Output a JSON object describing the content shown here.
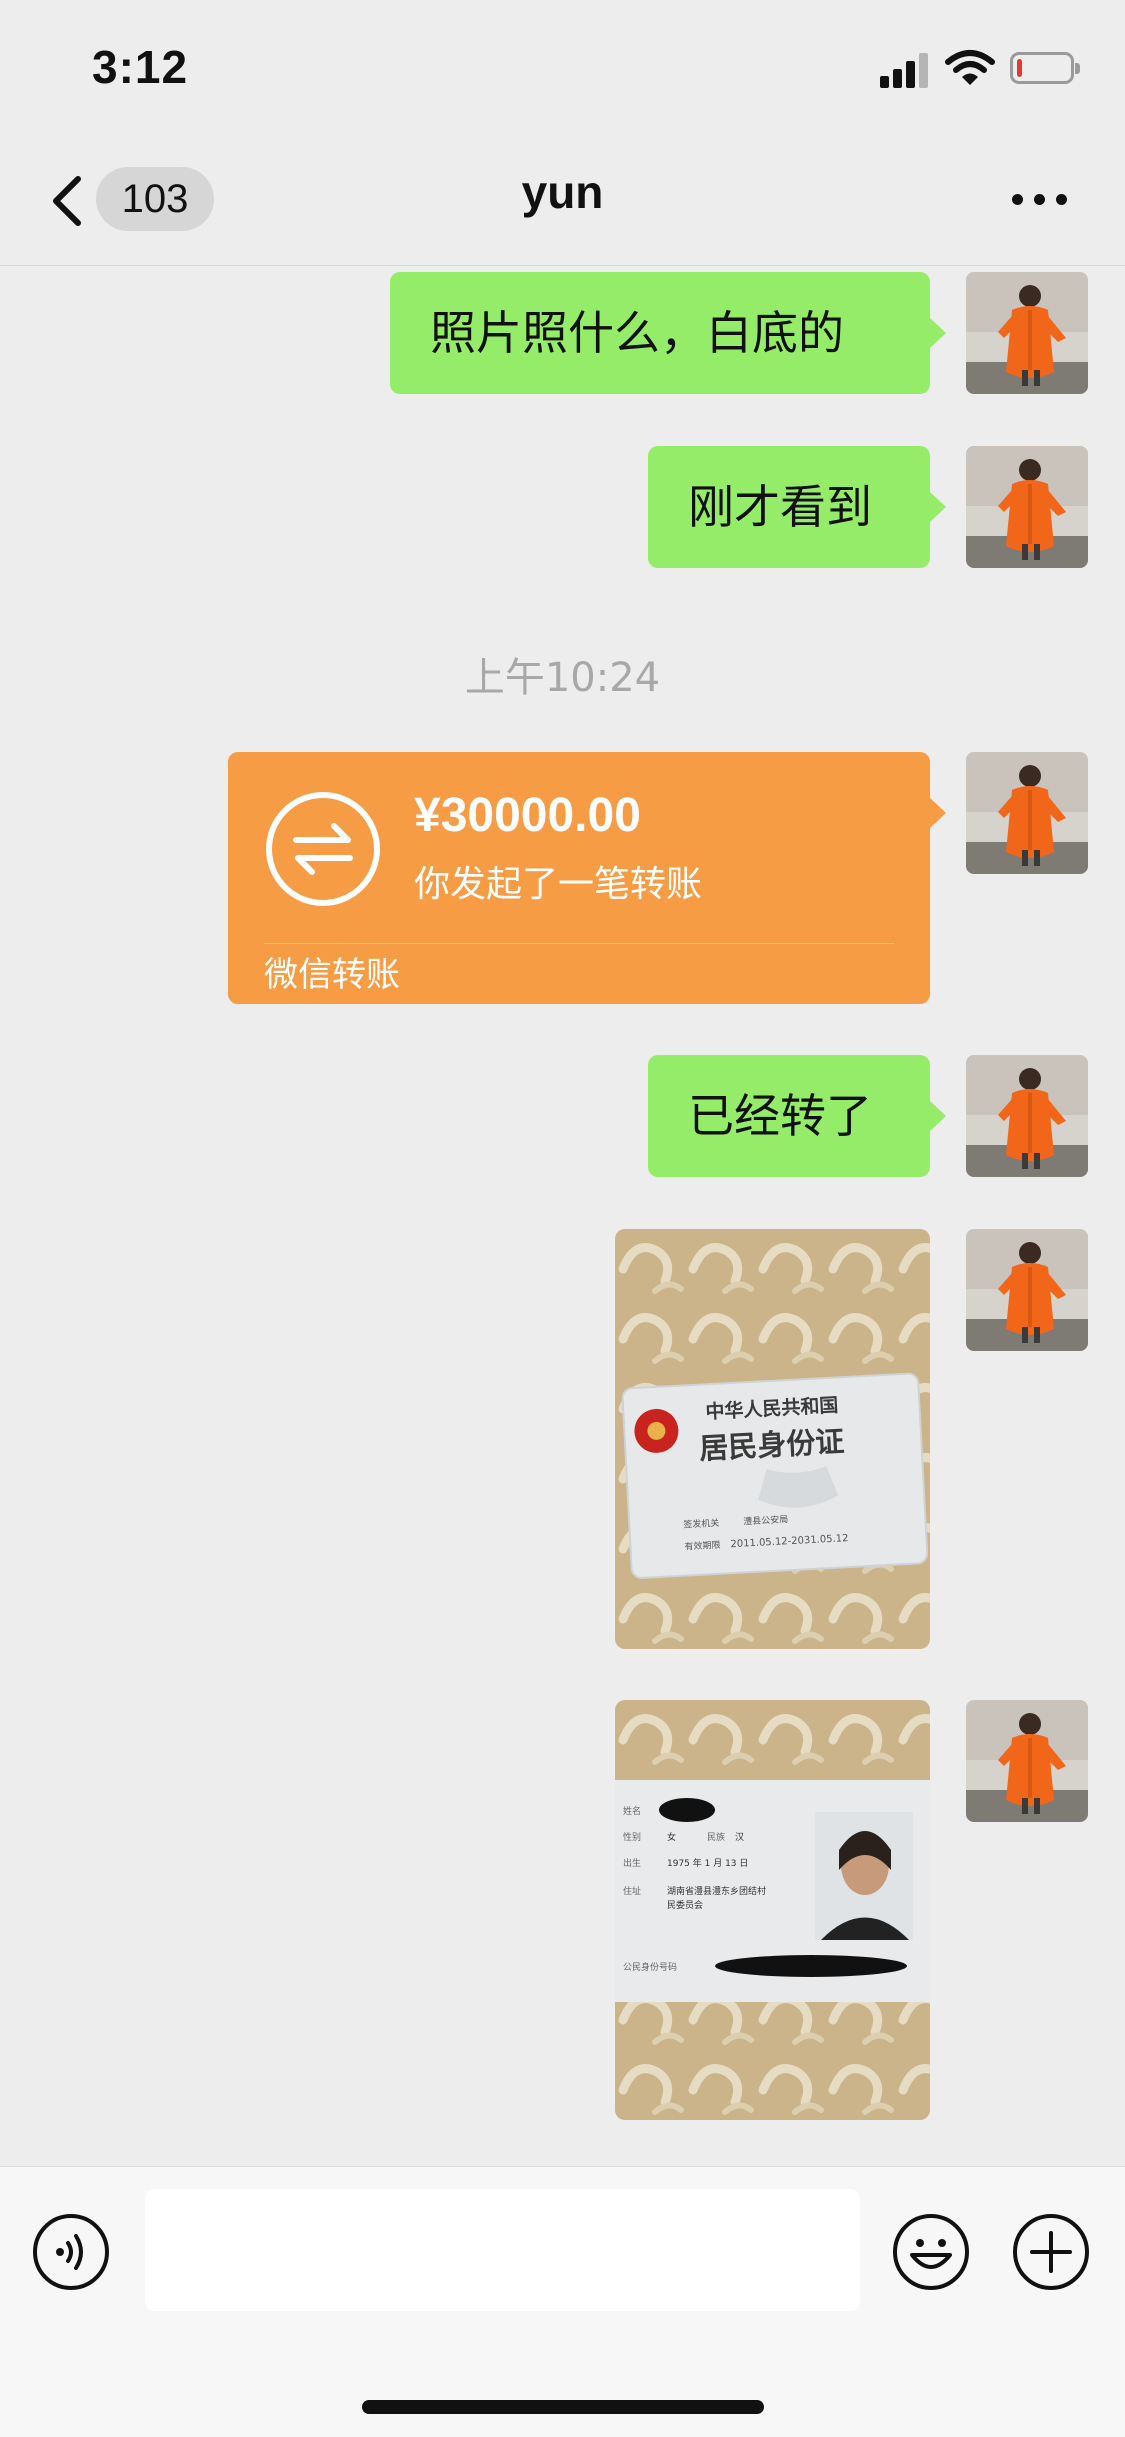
{
  "status_bar": {
    "time": "3:12",
    "battery_level": 0.1,
    "battery_color": "#e03b31"
  },
  "nav": {
    "unread_count": "103",
    "title": "yun"
  },
  "messages": {
    "m1": "照片照什么，白底的",
    "m2": "刚才看到",
    "timestamp": "上午10:24",
    "transfer": {
      "amount": "¥30000.00",
      "description": "你发起了一笔转账",
      "source": "微信转账"
    },
    "m3": "已经转了",
    "id_front": {
      "line1": "中华人民共和国",
      "line2": "居民身份证",
      "issuer_label": "签发机关",
      "issuer": "澧县公安局",
      "validity_label": "有效期限",
      "validity": "2011.05.12-2031.05.12"
    },
    "id_back": {
      "name_label": "姓名",
      "sex_label": "性别",
      "sex": "女",
      "ethnicity_label": "民族",
      "ethnicity": "汉",
      "birth_label": "出生",
      "birth": "1975 年 1 月 13 日",
      "address_label": "住址",
      "address_line1": "湖南省澧县澧东乡团结村",
      "address_line2": "民委员会",
      "id_label": "公民身份号码"
    }
  },
  "colors": {
    "sent_bubble": "#95ec69",
    "transfer_card": "#f69c44",
    "background": "#ededed"
  },
  "icons": {
    "back": "chevron-left-icon",
    "more": "ellipsis-icon",
    "voice": "voice-icon",
    "emoji": "smiley-icon",
    "plus": "plus-icon",
    "transfer": "exchange-arrows-icon"
  }
}
